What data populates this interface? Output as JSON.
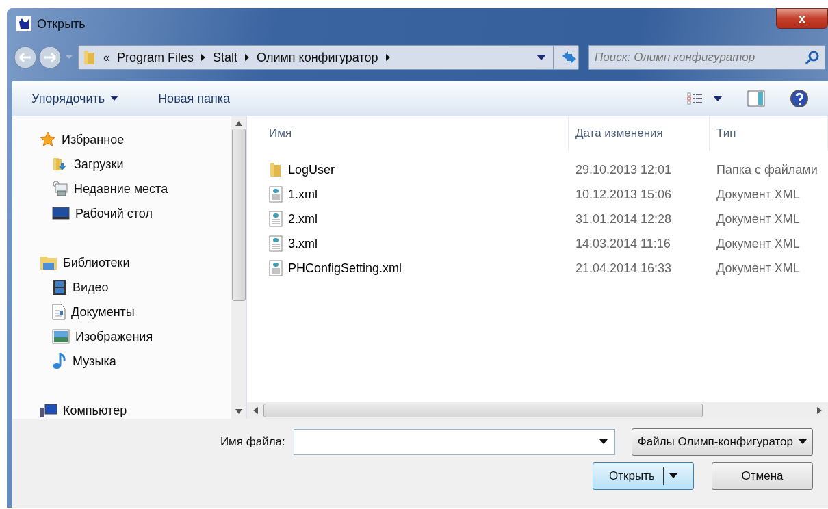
{
  "window": {
    "title": "Открыть",
    "close": "x"
  },
  "address": {
    "overflow": "«",
    "crumbs": [
      "Program Files",
      "Stalt",
      "Олимп конфигуратор"
    ]
  },
  "search": {
    "placeholder": "Поиск: Олимп конфигуратор"
  },
  "toolbar": {
    "organize": "Упорядочить",
    "new_folder": "Новая папка"
  },
  "sidebar": {
    "groups": [
      {
        "label": "Избранное",
        "kind": "star",
        "children": [
          {
            "label": "Загрузки",
            "kind": "downloads"
          },
          {
            "label": "Недавние места",
            "kind": "recent"
          },
          {
            "label": "Рабочий стол",
            "kind": "desktop"
          }
        ]
      },
      {
        "label": "Библиотеки",
        "kind": "library",
        "children": [
          {
            "label": "Видео",
            "kind": "video"
          },
          {
            "label": "Документы",
            "kind": "documents"
          },
          {
            "label": "Изображения",
            "kind": "images"
          },
          {
            "label": "Музыка",
            "kind": "music"
          }
        ]
      },
      {
        "label": "Компьютер",
        "kind": "computer"
      }
    ]
  },
  "table": {
    "columns": [
      "Имя",
      "Дата изменения",
      "Тип"
    ],
    "rows": [
      {
        "name": "LogUser",
        "date": "29.10.2013 12:01",
        "type": "Папка с файлами",
        "kind": "folder"
      },
      {
        "name": "1.xml",
        "date": "10.12.2013 15:06",
        "type": "Документ XML",
        "kind": "xml"
      },
      {
        "name": "2.xml",
        "date": "31.01.2014 12:28",
        "type": "Документ XML",
        "kind": "xml"
      },
      {
        "name": "3.xml",
        "date": "14.03.2014 11:16",
        "type": "Документ XML",
        "kind": "xml"
      },
      {
        "name": "PHConfigSetting.xml",
        "date": "21.04.2014 16:33",
        "type": "Документ XML",
        "kind": "xml"
      }
    ]
  },
  "bottom": {
    "filename_label": "Имя файла:",
    "filter": "Файлы Олимп-конфигуратор",
    "open": "Открыть",
    "cancel": "Отмена"
  }
}
